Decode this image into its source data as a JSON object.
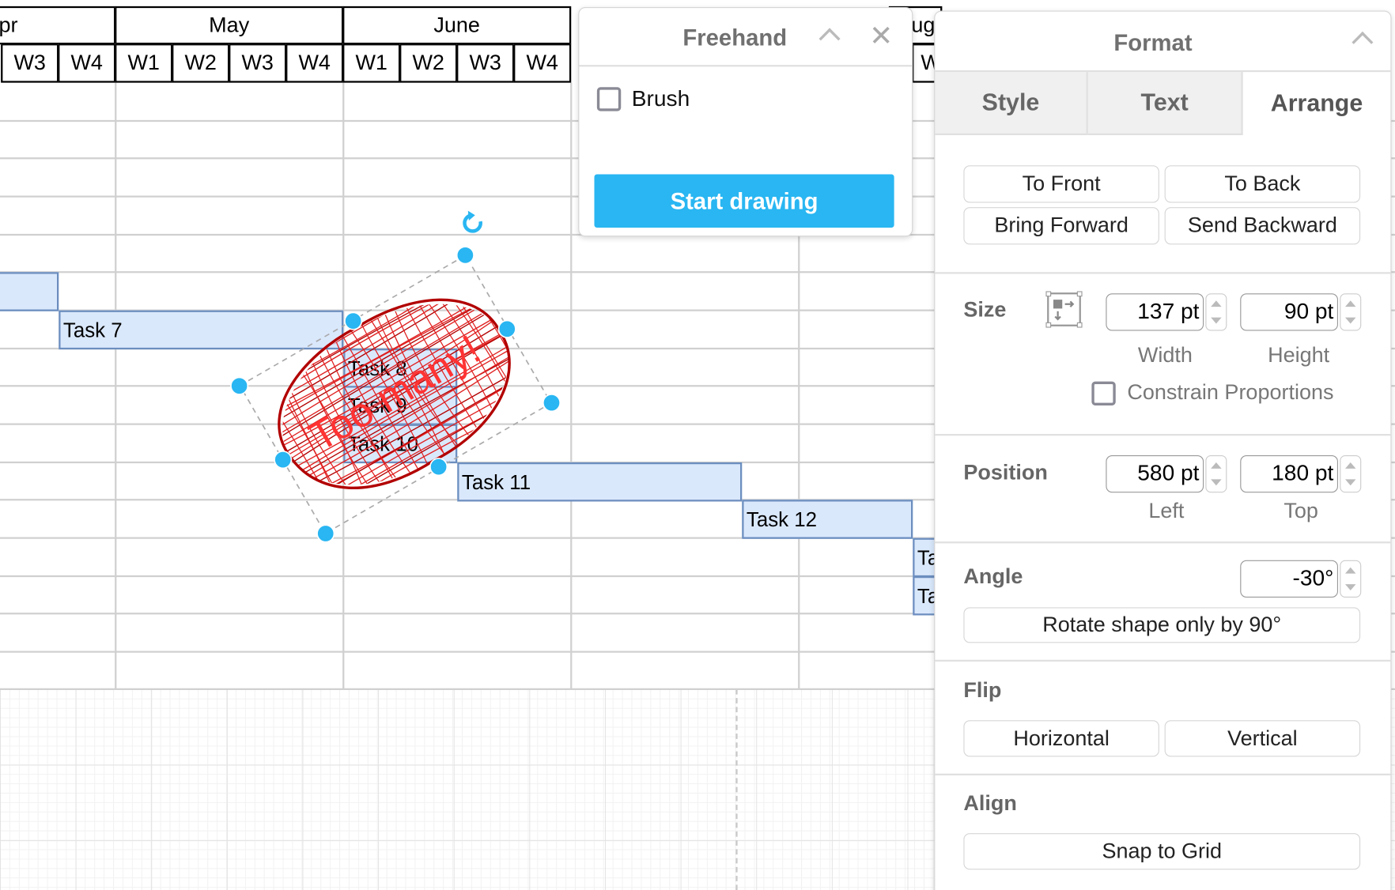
{
  "timeline": {
    "months": [
      "pr",
      "May",
      "June"
    ],
    "month_right_partial": "ug",
    "weeks": [
      "W3",
      "W4",
      "W1",
      "W2",
      "W3",
      "W4",
      "W1",
      "W2",
      "W3",
      "W4"
    ],
    "week_right_partial": "W"
  },
  "tasks": [
    {
      "label": ""
    },
    {
      "label": "Task 7"
    },
    {
      "label": "Task 8"
    },
    {
      "label": "Task 9"
    },
    {
      "label": "Task 10"
    },
    {
      "label": "Task 11"
    },
    {
      "label": "Task 12"
    },
    {
      "label": "Ta"
    },
    {
      "label": "Ta"
    }
  ],
  "shape": {
    "text": "Too many!",
    "stroke_color": "#b20000",
    "text_color": "#ff3333",
    "handle_color": "#29b6f2"
  },
  "freehand": {
    "title": "Freehand",
    "brush_label": "Brush",
    "brush_checked": false,
    "start_button": "Start drawing",
    "accent": "#29b6f2"
  },
  "format": {
    "title": "Format",
    "tabs": [
      {
        "label": "Style"
      },
      {
        "label": "Text"
      },
      {
        "label": "Arrange",
        "active": true
      }
    ],
    "order_buttons": [
      "To Front",
      "To Back",
      "Bring Forward",
      "Send Backward"
    ],
    "size": {
      "label": "Size",
      "width": "137 pt",
      "height": "90 pt",
      "width_label": "Width",
      "height_label": "Height",
      "constrain_label": "Constrain Proportions",
      "constrain_checked": false
    },
    "position": {
      "label": "Position",
      "left": "580 pt",
      "top": "180 pt",
      "left_label": "Left",
      "top_label": "Top"
    },
    "angle": {
      "label": "Angle",
      "value": "-30°",
      "rotate_button": "Rotate shape only by 90°"
    },
    "flip": {
      "label": "Flip",
      "horizontal": "Horizontal",
      "vertical": "Vertical"
    },
    "align": {
      "label": "Align",
      "snap_button": "Snap to Grid"
    }
  }
}
